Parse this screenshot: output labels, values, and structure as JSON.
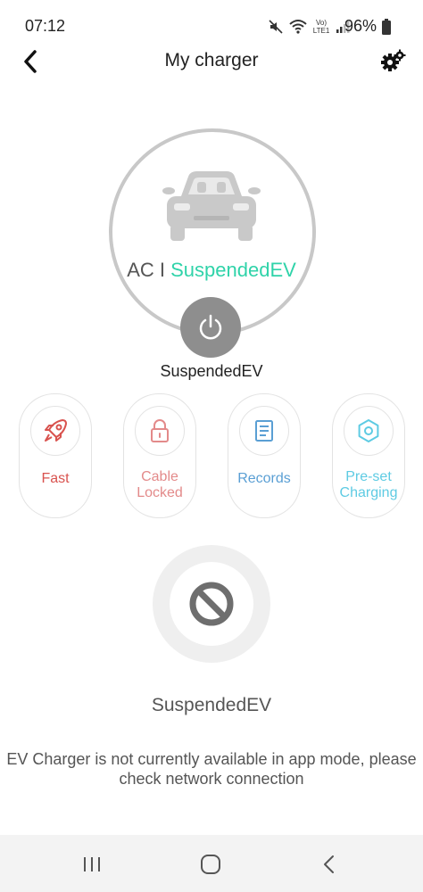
{
  "status_bar": {
    "time": "07:12",
    "battery": "96%",
    "network_label": "Vo) LTE1"
  },
  "header": {
    "title": "My charger",
    "back_icon": "chevron-left-icon",
    "settings_icon": "gear-icon"
  },
  "charger": {
    "mode": "AC",
    "separator": "I",
    "status": "SuspendedEV",
    "power_label": "SuspendedEV"
  },
  "features": [
    {
      "label": "Fast",
      "icon": "rocket-icon",
      "color": "#d9534f"
    },
    {
      "label_line1": "Cable",
      "label_line2": "Locked",
      "icon": "lock-icon",
      "color": "#e38a8a"
    },
    {
      "label": "Records",
      "icon": "records-icon",
      "color": "#5a9fd4"
    },
    {
      "label_line1": "Pre-set",
      "label_line2": "Charging",
      "icon": "hexagon-icon",
      "color": "#5ecbe3"
    }
  ],
  "suspended": {
    "title": "SuspendedEV",
    "notice_line1": "EV Charger is not currently available in app mode, please",
    "notice_line2": "check network connection"
  },
  "colors": {
    "status_accent": "#2fd3a9",
    "ring": "#c8c8c8",
    "power_button": "#8e8e8e"
  }
}
